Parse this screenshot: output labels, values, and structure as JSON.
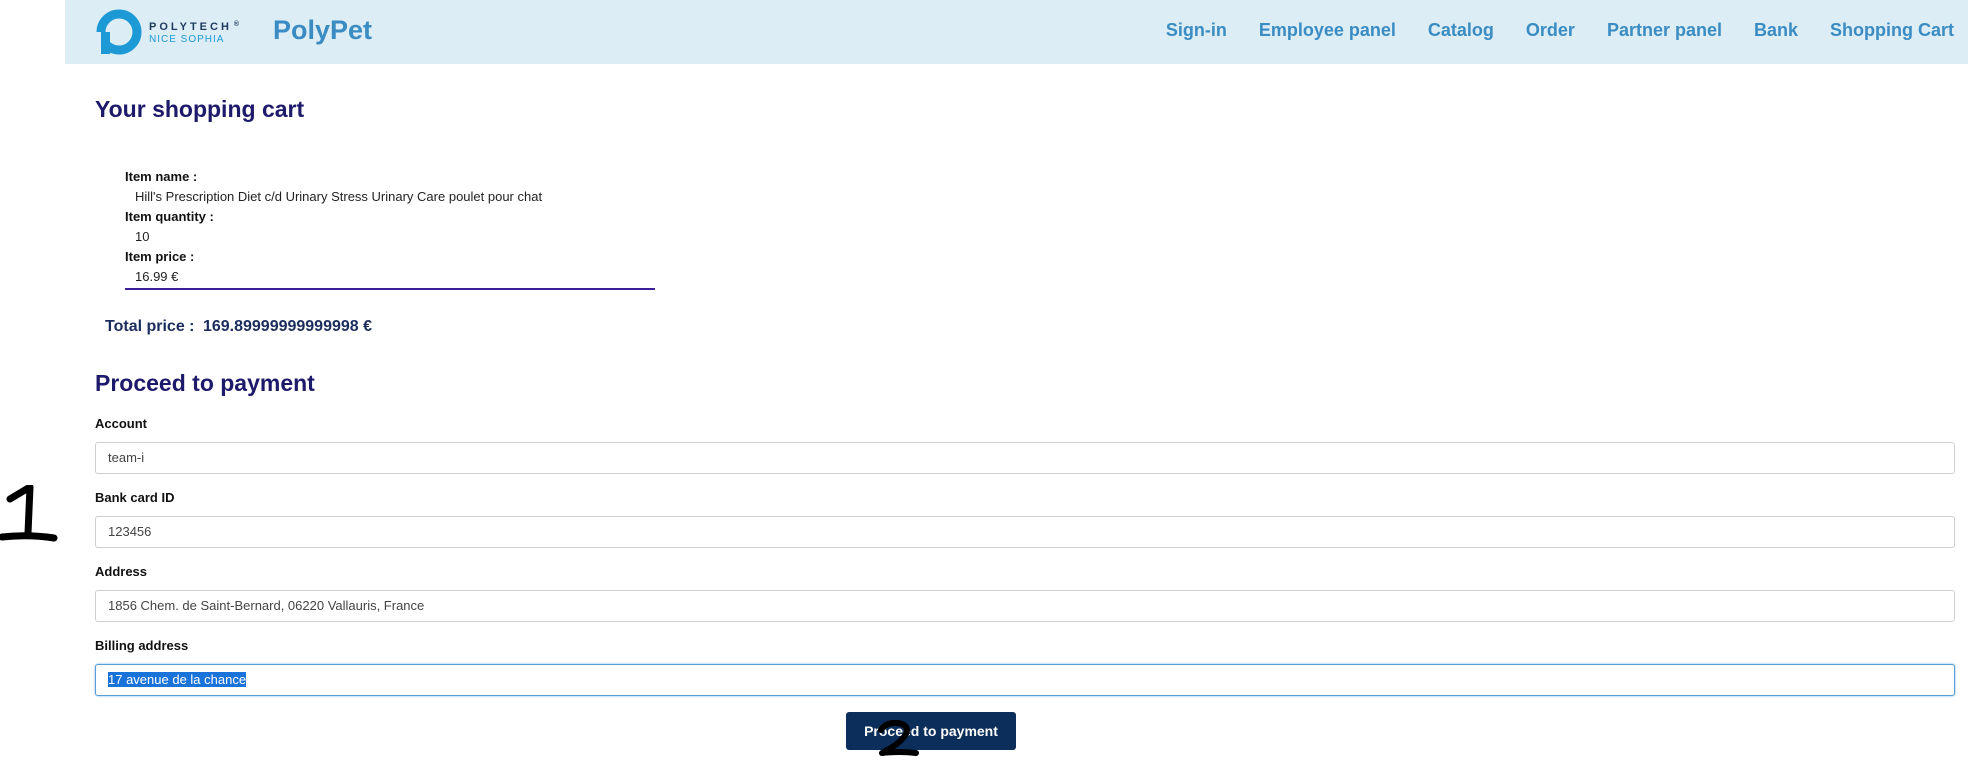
{
  "header": {
    "logo": {
      "top": "POLYTECH",
      "trademark": "®",
      "bottom": "NICE SOPHIA"
    },
    "brand": "PolyPet",
    "nav": [
      {
        "label": "Sign-in"
      },
      {
        "label": "Employee panel"
      },
      {
        "label": "Catalog"
      },
      {
        "label": "Order"
      },
      {
        "label": "Partner panel"
      },
      {
        "label": "Bank"
      },
      {
        "label": "Shopping Cart"
      }
    ]
  },
  "cart": {
    "title": "Your shopping cart",
    "item": {
      "name_label": "Item name :",
      "name": "Hill's Prescription Diet c/d Urinary Stress Urinary Care poulet pour chat",
      "quantity_label": "Item quantity :",
      "quantity": "10",
      "price_label": "Item price :",
      "price": "16.99 €"
    },
    "total_label": "Total price :",
    "total_value": "169.89999999999998 €"
  },
  "payment": {
    "title": "Proceed to payment",
    "account_label": "Account",
    "account_value": "team-i",
    "card_label": "Bank card ID",
    "card_value": "123456",
    "address_label": "Address",
    "address_value": "1856 Chem. de Saint-Bernard, 06220 Vallauris, France",
    "billing_label": "Billing address",
    "billing_value": "17 avenue de la chance",
    "button_label": "Proceed to payment"
  },
  "annotations": {
    "one": "1",
    "two": "2"
  },
  "colors": {
    "navbar_bg": "#dcedf5",
    "nav_link": "#3a8cc3",
    "heading": "#1e1a6b",
    "button_bg": "#0b2e5b",
    "selection": "#1a73d9"
  }
}
